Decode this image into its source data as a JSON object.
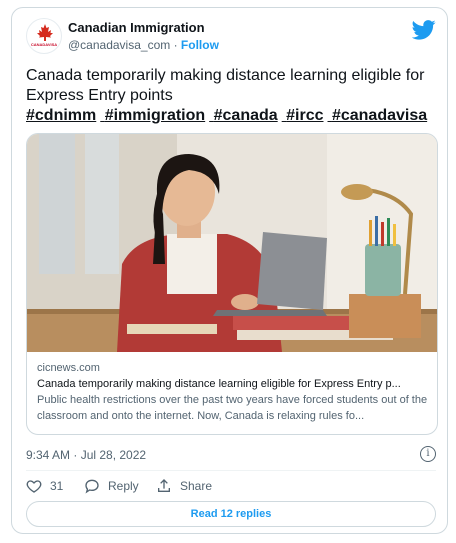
{
  "account": {
    "name": "Canadian Immigration",
    "handle": "@canadavisa_com",
    "separator": "·",
    "follow_label": "Follow",
    "avatar_text": "CANADAVISA"
  },
  "tweet": {
    "text": "Canada temporarily making distance learning eligible for Express Entry points",
    "hashtags": [
      "#cdnimm",
      "#immigration",
      "#canada",
      "#ircc",
      "#canadavisa"
    ]
  },
  "link_card": {
    "site": "cicnews.com",
    "title": "Canada temporarily making distance learning eligible for Express Entry p...",
    "description": "Public health restrictions over the past two years have forced students out of the classroom and onto the internet. Now, Canada is relaxing rules fo..."
  },
  "timestamp": "9:34 AM · Jul 28, 2022",
  "actions": {
    "likes": "31",
    "reply_label": "Reply",
    "share_label": "Share"
  },
  "read_replies_label": "Read 12 replies",
  "colors": {
    "accent": "#1d9bf0",
    "text": "#0f1419",
    "muted": "#536471",
    "border": "#cfd9de"
  }
}
